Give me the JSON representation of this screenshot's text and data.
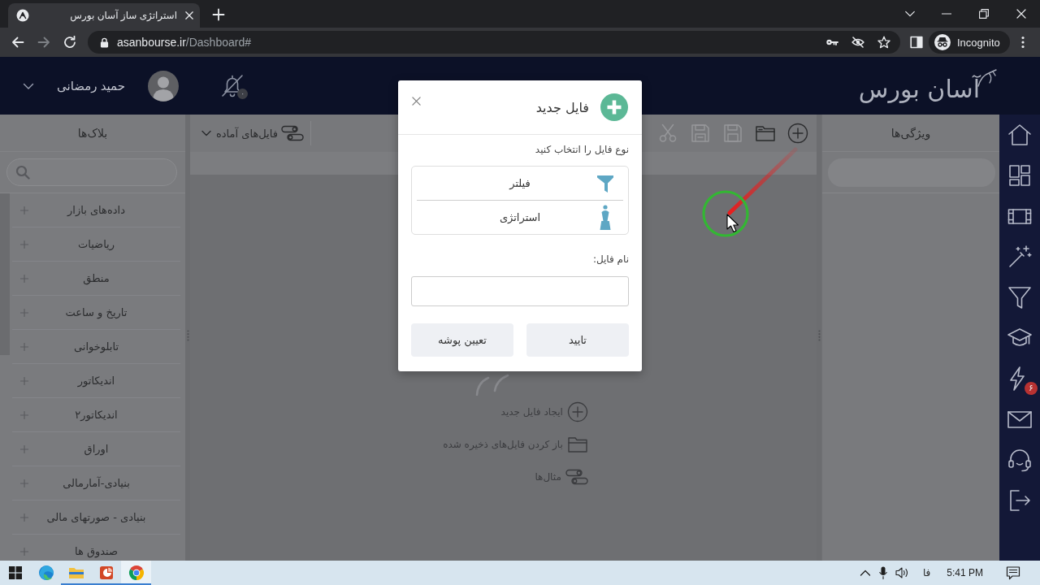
{
  "browser": {
    "tabs": [
      {
        "title": "استراتژی ساز آسان بورس",
        "selected": true
      }
    ],
    "address": {
      "host": "asanbourse.ir",
      "path": "/Dashboard#"
    },
    "forward": {
      "disabled": true
    },
    "profile": "Incognito"
  },
  "header": {
    "logo": "آسان بورس",
    "user_name": "حمید رمضانی",
    "notification_badge": "۰"
  },
  "blocks_panel": {
    "title": "بلاک‌ها",
    "items": [
      "داده‌های بازار",
      "ریاضیات",
      "منطق",
      "تاریخ و ساعت",
      "تابلوخوانی",
      "اندیکاتور",
      "اندیکاتور۲",
      "اوراق",
      "بنیادی-آمارمالی",
      "بنیادی - صورتهای مالی",
      "صندوق ها"
    ]
  },
  "editor": {
    "toolbar": [
      {
        "kind": "new",
        "disabled": false
      },
      {
        "kind": "open",
        "disabled": false
      },
      {
        "kind": "save",
        "disabled": true
      },
      {
        "kind": "save_as",
        "disabled": true
      },
      {
        "kind": "cut",
        "disabled": true
      }
    ],
    "ready_files": "فایل‌های آماده",
    "empty_state": [
      {
        "kind": "new",
        "label": "ایجاد فایل جدید"
      },
      {
        "kind": "open",
        "label": "باز کردن فایل‌های ذخیره شده"
      },
      {
        "kind": "examples",
        "label": "مثال‌ها"
      }
    ]
  },
  "properties_panel": {
    "title": "ویژگی‌ها"
  },
  "nav_rail": [
    {
      "kind": "home"
    },
    {
      "kind": "dashboard"
    },
    {
      "kind": "film"
    },
    {
      "kind": "wand"
    },
    {
      "kind": "filter"
    },
    {
      "kind": "cap"
    },
    {
      "kind": "lightning",
      "badge": "۶"
    },
    {
      "kind": "mail"
    },
    {
      "kind": "headset"
    },
    {
      "kind": "logout"
    }
  ],
  "dialog": {
    "title": "فایل جدید",
    "type_prompt": "نوع فایل را انتخاب کنید",
    "file_types": [
      {
        "kind": "filter",
        "label": "فیلتر",
        "selected": false
      },
      {
        "kind": "strategy",
        "label": "استراتژی",
        "selected": false
      }
    ],
    "name_label": "نام فایل:",
    "buttons": [
      "تایید",
      "تعیین پوشه"
    ]
  },
  "taskbar": {
    "apps": [
      {
        "kind": "edge",
        "running": false,
        "selected": false
      },
      {
        "kind": "explorer",
        "running": true,
        "selected": false
      },
      {
        "kind": "powerpoint",
        "running": true,
        "selected": false
      },
      {
        "kind": "chrome",
        "running": true,
        "selected": true
      }
    ],
    "language": "فا",
    "time": "5:41 PM"
  }
}
